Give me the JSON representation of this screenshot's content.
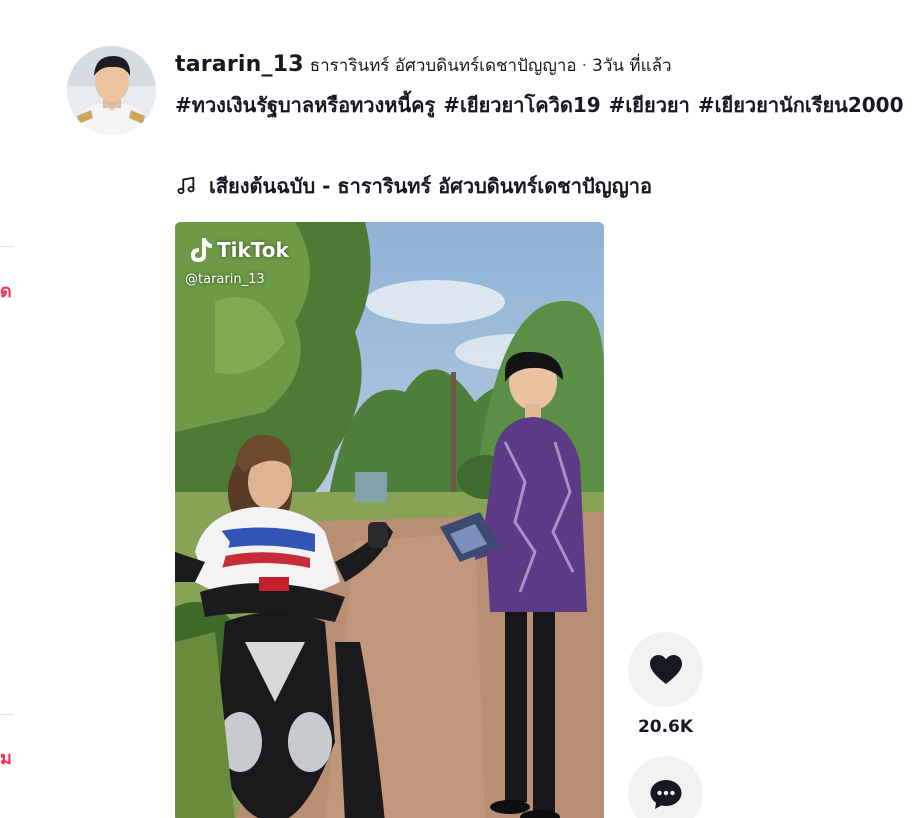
{
  "left_panel": {
    "text_1": "ด",
    "text_2": "ม"
  },
  "post": {
    "username": "tararin_13",
    "nickname": "ธารารินทร์ อัศวบดินทร์เดชาปัญญาอ",
    "separator": "·",
    "time": "3วัน ที่แล้ว",
    "hashtags": [
      "#ทวงเงินรัฐบาลหรือทวงหนี้ครู",
      "#เยียวยาโควิด19",
      "#เยียวยา",
      "#เยียวยานักเรียน2000"
    ],
    "music": "เสียงต้นฉบับ - ธารารินทร์ อัศวบดินทร์เดชาปัญญาอ"
  },
  "video": {
    "watermark_brand": "TikTok",
    "watermark_handle": "@tararin_13"
  },
  "actions": {
    "like_count": "20.6K",
    "like_icon": "heart-icon",
    "comment_icon": "comment-icon"
  },
  "colors": {
    "accent": "#fe2c55",
    "text": "#161823",
    "action_bg": "#f1f1f2"
  }
}
